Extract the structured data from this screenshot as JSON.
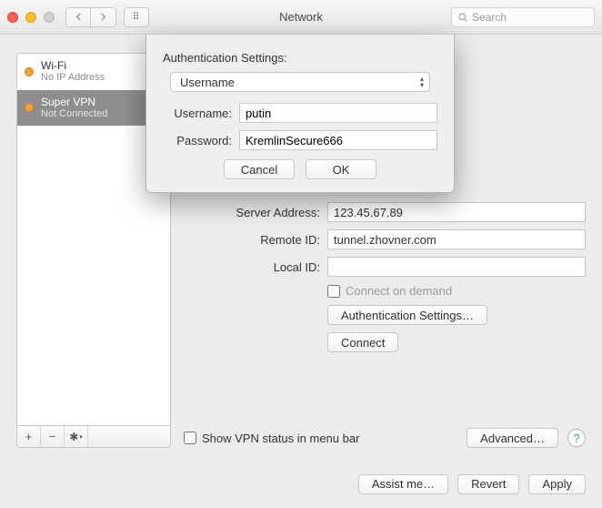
{
  "window": {
    "title": "Network"
  },
  "search": {
    "placeholder": "Search"
  },
  "sidebar": {
    "items": [
      {
        "name": "Wi-Fi",
        "sub": "No IP Address"
      },
      {
        "name": "Super VPN",
        "sub": "Not Connected"
      }
    ]
  },
  "detail": {
    "server_label": "Server Address:",
    "server_value": "123.45.67.89",
    "remote_label": "Remote ID:",
    "remote_value": "tunnel.zhovner.com",
    "local_label": "Local ID:",
    "local_value": "",
    "connect_on_demand": "Connect on demand",
    "auth_settings_btn": "Authentication Settings…",
    "connect_btn": "Connect",
    "show_status": "Show VPN status in menu bar",
    "advanced_btn": "Advanced…"
  },
  "footer": {
    "assist": "Assist me…",
    "revert": "Revert",
    "apply": "Apply"
  },
  "sheet": {
    "heading": "Authentication Settings:",
    "method": "Username",
    "username_label": "Username:",
    "username_value": "putin",
    "password_label": "Password:",
    "password_value": "KremlinSecure666",
    "cancel": "Cancel",
    "ok": "OK"
  }
}
